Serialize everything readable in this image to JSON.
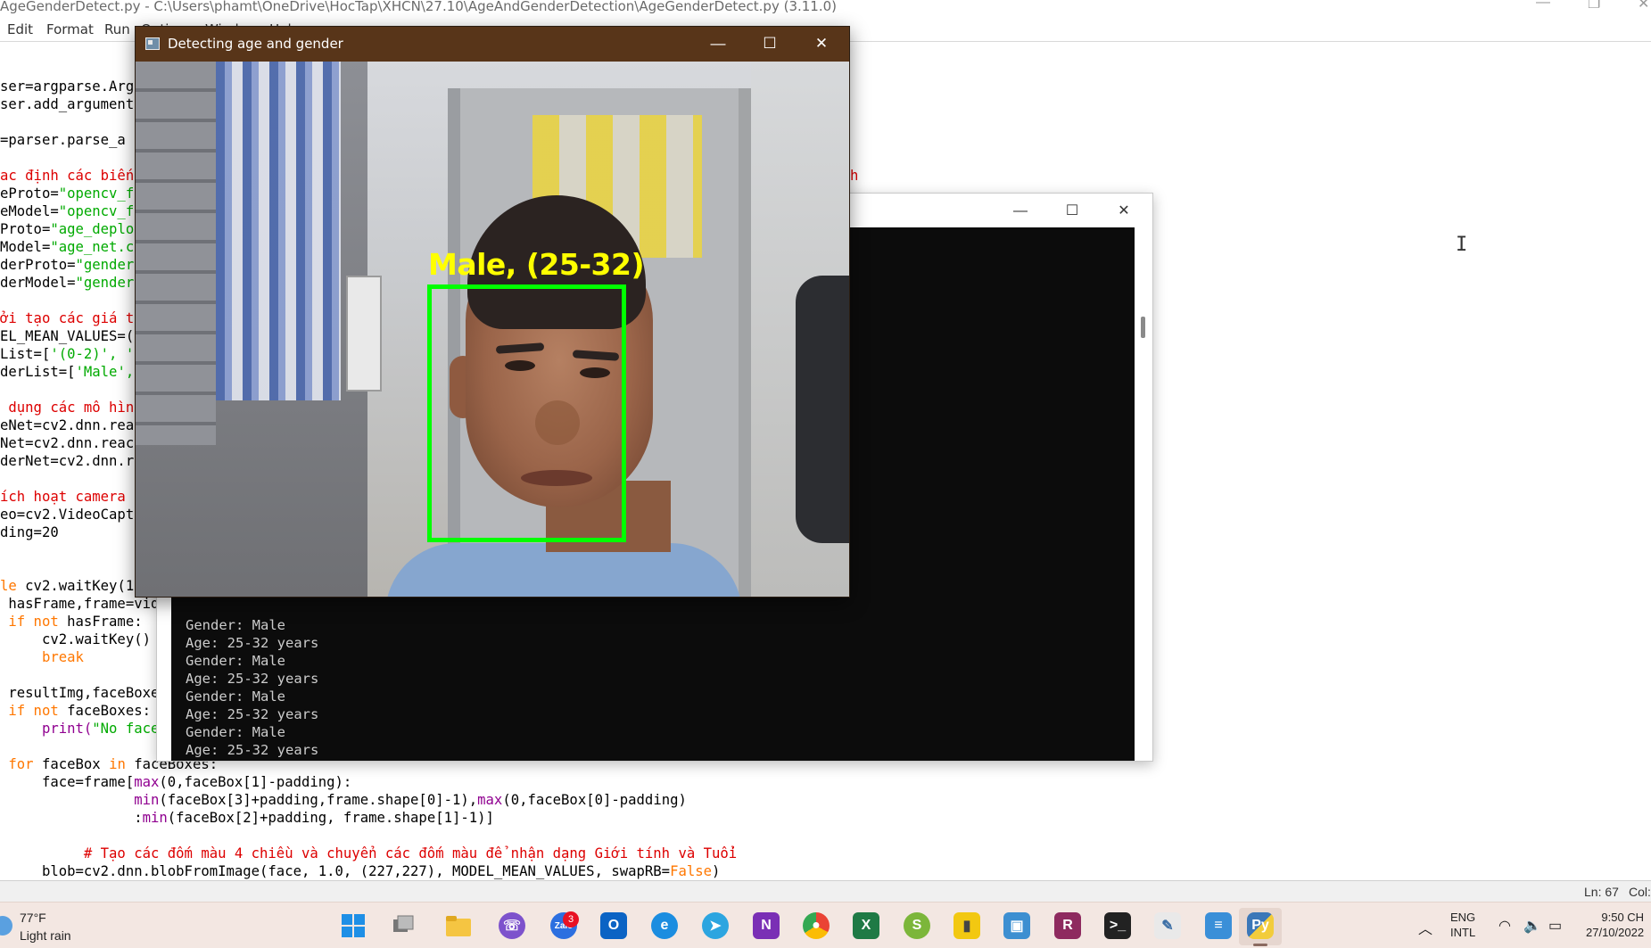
{
  "idle": {
    "title": "AgeGenderDetect.py - C:\\Users\\phamt\\OneDrive\\HocTap\\XHCN\\27.10\\AgeAndGenderDetection\\AgeGenderDetect.py (3.11.0)",
    "menu": [
      "Edit",
      "Format",
      "Run",
      "Options",
      "Window",
      "Help"
    ],
    "status_line": "Ln: 67",
    "status_col": "Col:"
  },
  "code": {
    "l1": "ser=argparse.Arg",
    "l2": "ser.add_argument",
    "l3": "=parser.parse_a",
    "l4": "ac định các biến",
    "l4b": "h",
    "l5a": "eProto=",
    "l5b": "\"opencv_f",
    "l6a": "eModel=",
    "l6b": "\"opencv_f",
    "l7a": "Proto=",
    "l7b": "\"age_deplo",
    "l8a": "Model=",
    "l8b": "\"age_net.c",
    "l9a": "derProto=",
    "l9b": "\"gender",
    "l10a": "derModel=",
    "l10b": "\"gender",
    "l11": "ởi tạo các giá t",
    "l12": "EL_MEAN_VALUES=(",
    "l13a": "List=[",
    "l13b": "'(0-2)', '",
    "l14a": "derList=[",
    "l14b": "'Male',",
    "l15": " dụng các mô hìn",
    "l16": "eNet=cv2.dnn.rea",
    "l17": "Net=cv2.dnn.reac",
    "l18": "derNet=cv2.dnn.r",
    "l19": "ích hoạt camera",
    "l20": "eo=cv2.VideoCapt",
    "l21": "ding=20",
    "l22a": "le",
    "l22b": " cv2.waitKey(1",
    "l23": " hasFrame,frame=vide",
    "l24a": " if not",
    "l24b": " hasFrame:",
    "l25": "     cv2.waitKey()",
    "l26": "     break",
    "l27": " resultImg,faceBoxes",
    "l28a": " if not",
    "l28b": " faceBoxes:",
    "l29a": "     print(",
    "l29b": "\"No face",
    "l30a": " for",
    "l30b": " faceBox ",
    "l30c": "in",
    "l30d": " faceBoxes:",
    "l31a": "     face=frame[",
    "l31b": "max",
    "l31c": "(0,faceBox[1]-padding):",
    "l32a": "                ",
    "l32b": "min",
    "l32c": "(faceBox[3]+padding,frame.shape[0]-1),",
    "l32d": "max",
    "l32e": "(0,faceBox[0]-padding)",
    "l33a": "                :",
    "l33b": "min",
    "l33c": "(faceBox[2]+padding, frame.shape[1]-1)]",
    "l34": "          # Tạo các đốm màu 4 chiều và chuyển các đốm màu để nhận dạng Giới tính và Tuổi",
    "l35a": "     blob=cv2.dnn.blobFromImage(face, 1.0, (227,227), MODEL_MEAN_VALUES, swapRB=",
    "l35b": "False",
    "l35c": ")"
  },
  "console": {
    "lines": [
      "Gender: Male",
      "Age: 25-32 years",
      "Gender: Male",
      "Age: 25-32 years",
      "Gender: Male",
      "Age: 25-32 years",
      "Gender: Male",
      "Age: 25-32 years"
    ]
  },
  "detect": {
    "title": "Detecting age and gender",
    "label": "Male, (25-32)"
  },
  "taskbar": {
    "weather_temp": "77°F",
    "weather_desc": "Light rain",
    "badge": "3",
    "lang_top": "ENG",
    "lang_bottom": "INTL",
    "time": "9:50 CH",
    "date": "27/10/2022",
    "icons": [
      "windows-start",
      "task-view",
      "file-explorer",
      "viber",
      "zalo",
      "outlook",
      "edge",
      "telegram",
      "onenote",
      "chrome",
      "excel",
      "snake",
      "power-bi",
      "screenshot",
      "winrar",
      "terminal",
      "notepad-file",
      "notepad",
      "python"
    ]
  },
  "colors": {
    "face_box": "#00ff00",
    "face_label": "#ffff00",
    "detect_titlebar": "#583519",
    "console_bg": "#0c0c0c"
  }
}
